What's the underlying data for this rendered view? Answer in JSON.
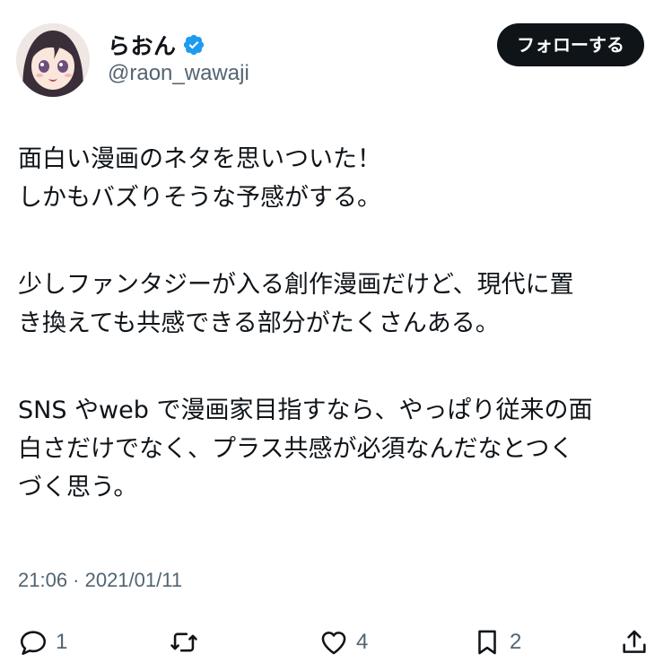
{
  "user": {
    "display_name": "らおん",
    "handle": "@raon_wawaji",
    "verified": true,
    "verified_color": "#1d9bf0"
  },
  "follow_button": {
    "label": "フォローする"
  },
  "tweet": {
    "lines": [
      "面白い漫画のネタを思いついた！",
      "しかもバズりそうな予感がする。",
      "少しファンタジーが入る創作漫画だけど、現代に置",
      "き換えても共感できる部分がたくさんある。",
      "SNS やweb で漫画家目指すなら、やっぱり従来の面",
      "白さだけでなく、プラス共感が必須なんだなとつく",
      "づく思う。"
    ],
    "timestamp": "21:06 · 2021/01/11"
  },
  "actions": {
    "reply": {
      "icon": "reply-icon",
      "count": "1"
    },
    "retweet": {
      "icon": "retweet-icon",
      "count": ""
    },
    "like": {
      "icon": "heart-icon",
      "count": "4"
    },
    "bookmark": {
      "icon": "bookmark-icon",
      "count": "2"
    },
    "share": {
      "icon": "share-icon"
    }
  }
}
